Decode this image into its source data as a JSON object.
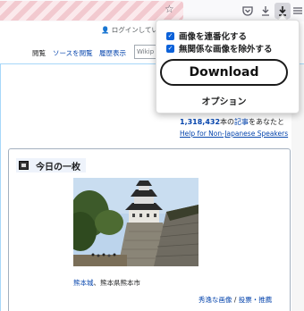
{
  "toolbar": {
    "star_icon": "star-icon",
    "pocket_icon": "pocket-icon",
    "downloads_icon": "downloads-icon",
    "extension_icon": "download-arrow-icon",
    "menu_icon": "hamburger-menu-icon"
  },
  "wiki": {
    "userlinks": "ログインしていま",
    "tabs": [
      "閲覧",
      "ソースを閲覧",
      "履歴表示"
    ],
    "search_placeholder": "Wikip",
    "article_count_number": "1,318,432",
    "article_count_mid": "本の",
    "article_count_link": "記事",
    "article_count_end": "をあなたと",
    "help_link": "Help for Non-Japanese Speakers",
    "panel_title": "今日の一枚",
    "caption_link1": "熊本城",
    "caption_sep": "、",
    "caption_text": "熊本県熊本市",
    "bottom_link1": "秀逸な画像",
    "bottom_sep": " / ",
    "bottom_link2": "投票・推薦"
  },
  "popup": {
    "option1": "画像を連番化する",
    "option2": "無関係な画像を除外する",
    "download_button": "Download",
    "options_link": "オプション"
  },
  "colors": {
    "link": "#0645ad",
    "checkbox": "#0b61d9",
    "tab_border": "#a7d7f9"
  }
}
